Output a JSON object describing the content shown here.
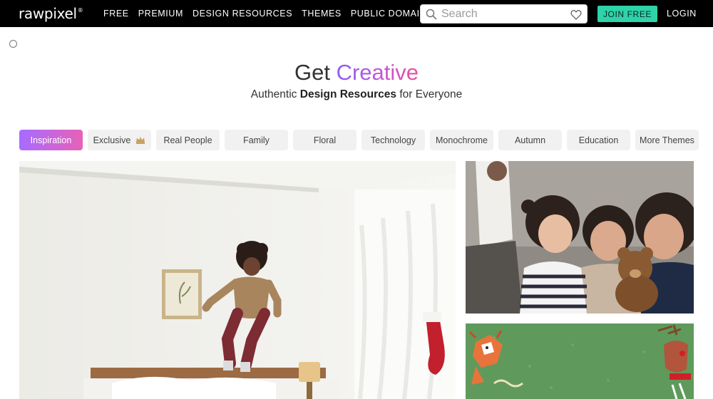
{
  "header": {
    "logo": "rawpixel",
    "logo_mark": "®",
    "nav": [
      "FREE",
      "PREMIUM",
      "DESIGN RESOURCES",
      "THEMES",
      "PUBLIC DOMAIN"
    ],
    "search_placeholder": "Search",
    "join_label": "JOIN FREE",
    "login_label": "LOGIN"
  },
  "hero": {
    "title_plain": "Get",
    "title_accent": "Creative",
    "subtitle_pre": "Authentic",
    "subtitle_bold": "Design Resources",
    "subtitle_post": "for Everyone"
  },
  "chips": [
    "Inspiration",
    "Exclusive",
    "Real People",
    "Family",
    "Floral",
    "Technology",
    "Monochrome",
    "Autumn",
    "Education",
    "More Themes"
  ],
  "colors": {
    "accent_green": "#2ed3a8",
    "gradient_start": "#a66cff",
    "gradient_end": "#e861b8"
  },
  "icons": {
    "search": "search-icon",
    "favorite": "heart-icon",
    "exclusive": "crown-icon"
  }
}
